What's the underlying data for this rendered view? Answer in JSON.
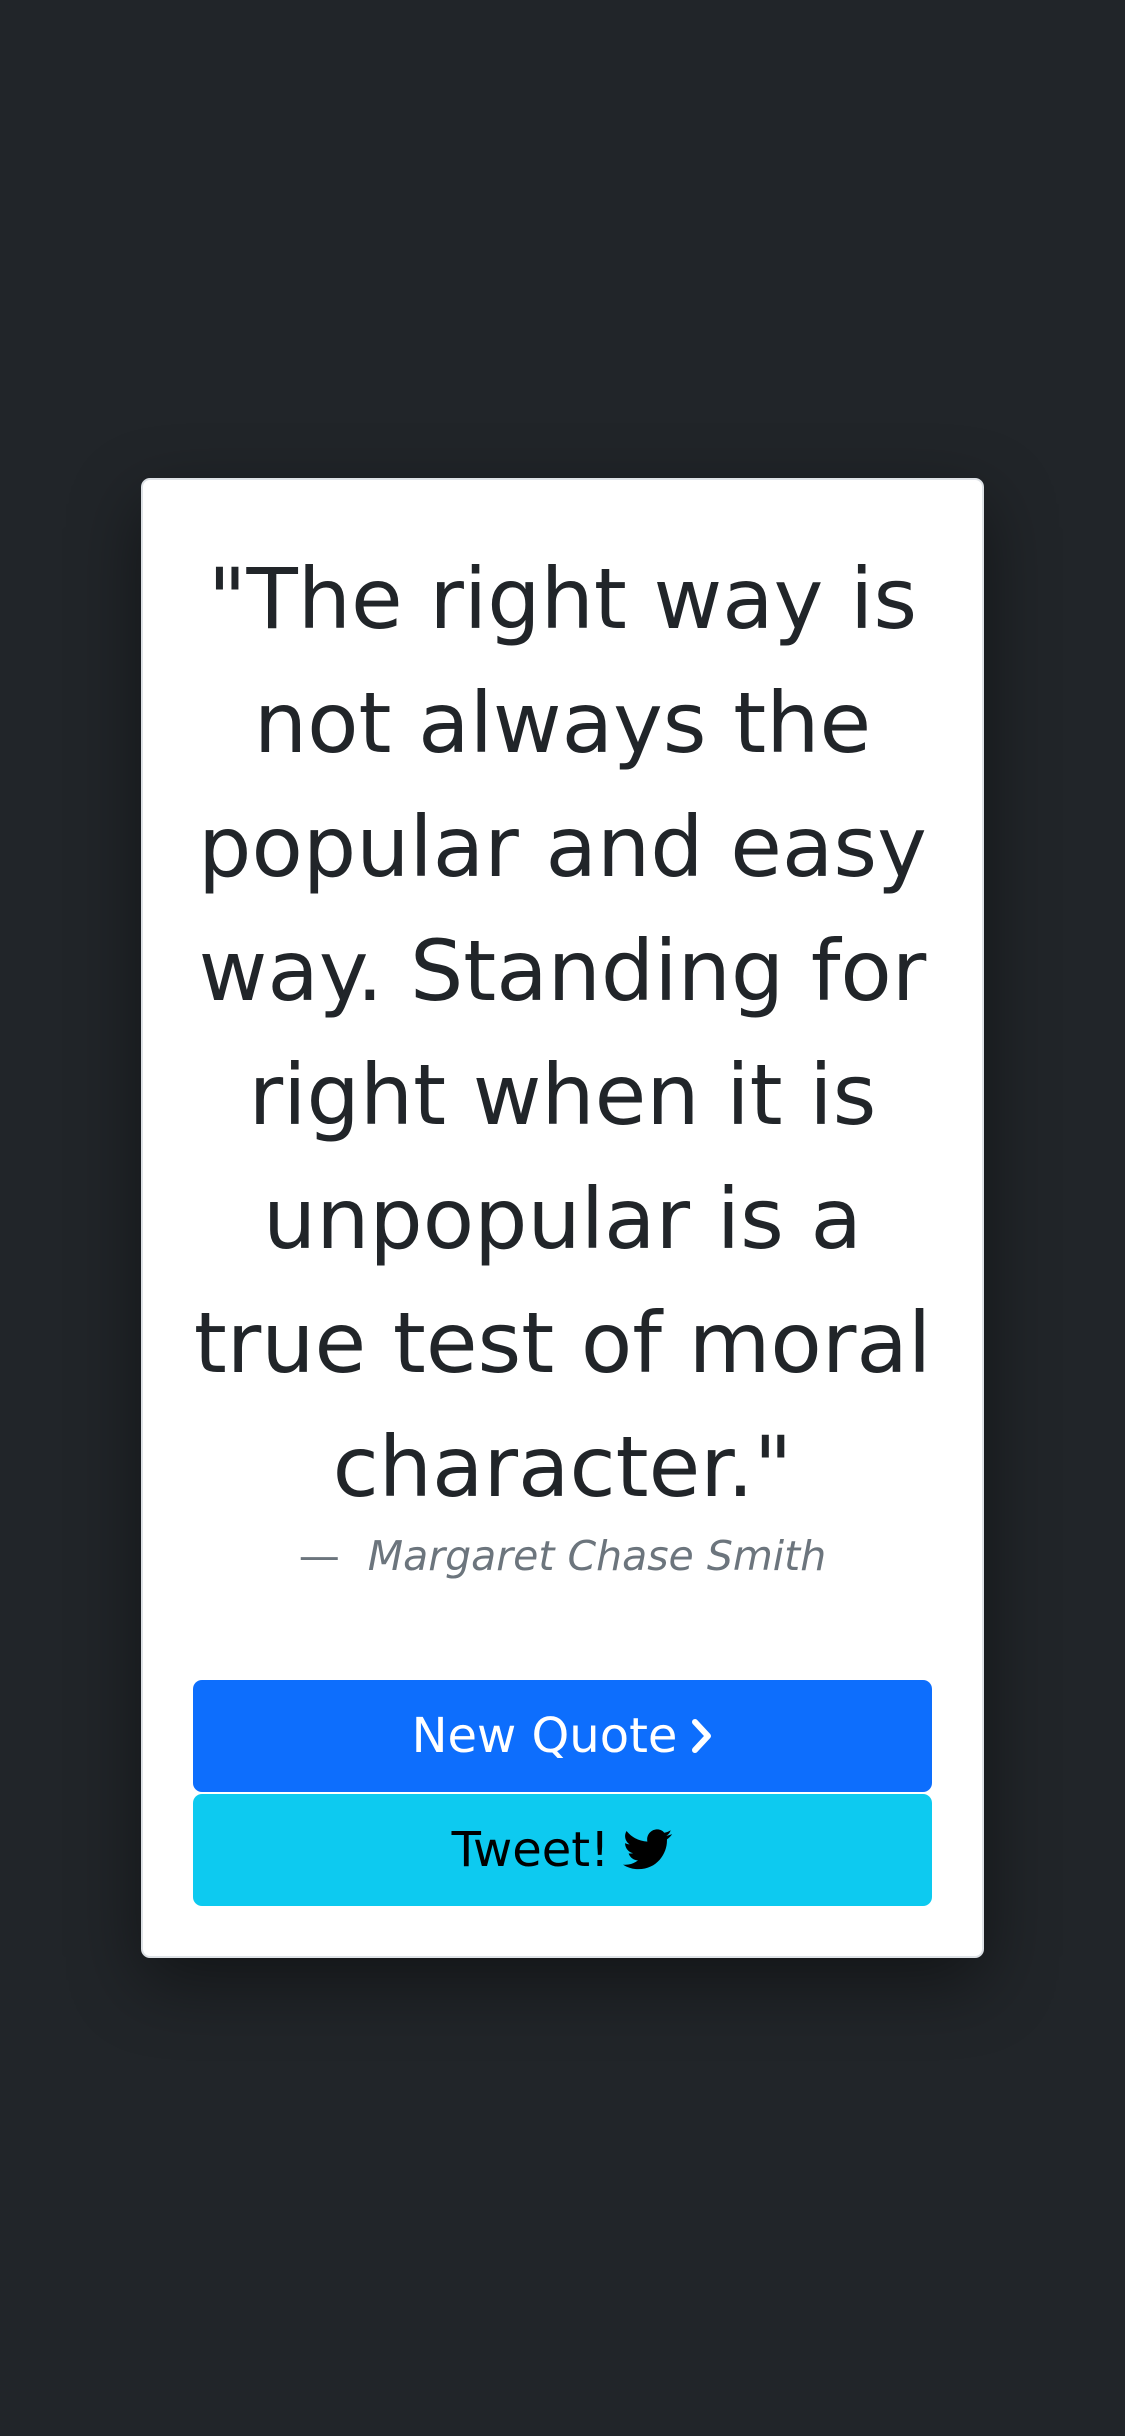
{
  "quote": {
    "text": "\"The right way is not always the popular and easy way. Standing for right when it is unpopular is a true test of moral character.\"",
    "author_dash": "—",
    "author": "Margaret Chase Smith"
  },
  "buttons": {
    "new_quote_label": "New Quote",
    "new_quote_icon": "chevron-right-icon",
    "tweet_label": "Tweet!",
    "tweet_icon": "twitter-bird-icon"
  },
  "colors": {
    "background": "#212529",
    "card": "#ffffff",
    "primary": "#0d6efd",
    "info": "#0dcaf0",
    "text": "#212529",
    "muted": "#6c757d"
  }
}
